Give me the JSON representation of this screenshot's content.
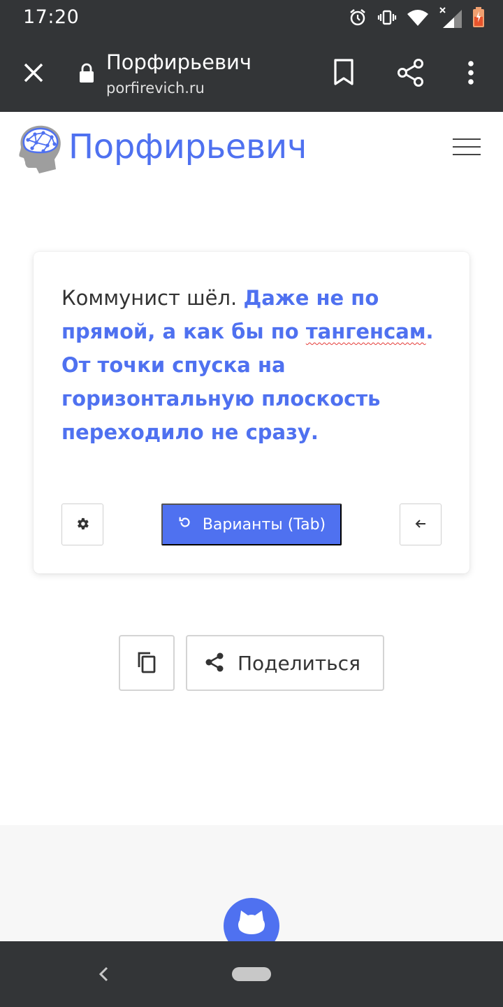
{
  "status_bar": {
    "time": "17:20",
    "icons": [
      "alarm-icon",
      "vibrate-icon",
      "wifi-icon",
      "signal-icon",
      "battery-icon"
    ]
  },
  "browser": {
    "page_title": "Порфирьевич",
    "url": "porfirevich.ru",
    "icons": [
      "close-icon",
      "lock-icon",
      "bookmark-icon",
      "share-icon",
      "more-vert-icon"
    ]
  },
  "site": {
    "brand": "Порфирьевич",
    "brand_color": "#4f71f0"
  },
  "editor": {
    "user_text": "Коммунист шёл. ",
    "generated_before": "Даже не по прямой, а как бы по ",
    "generated_misspelled": "тангенсам",
    "generated_after": ". От точки спуска на горизонтальную плоскость переходило не сразу.",
    "variants_button": "Варианты (Tab)"
  },
  "actions": {
    "share_label": "Поделиться"
  },
  "colors": {
    "accent": "#4f71f0",
    "bars": "#333537",
    "spellcheck": "#e53935"
  }
}
